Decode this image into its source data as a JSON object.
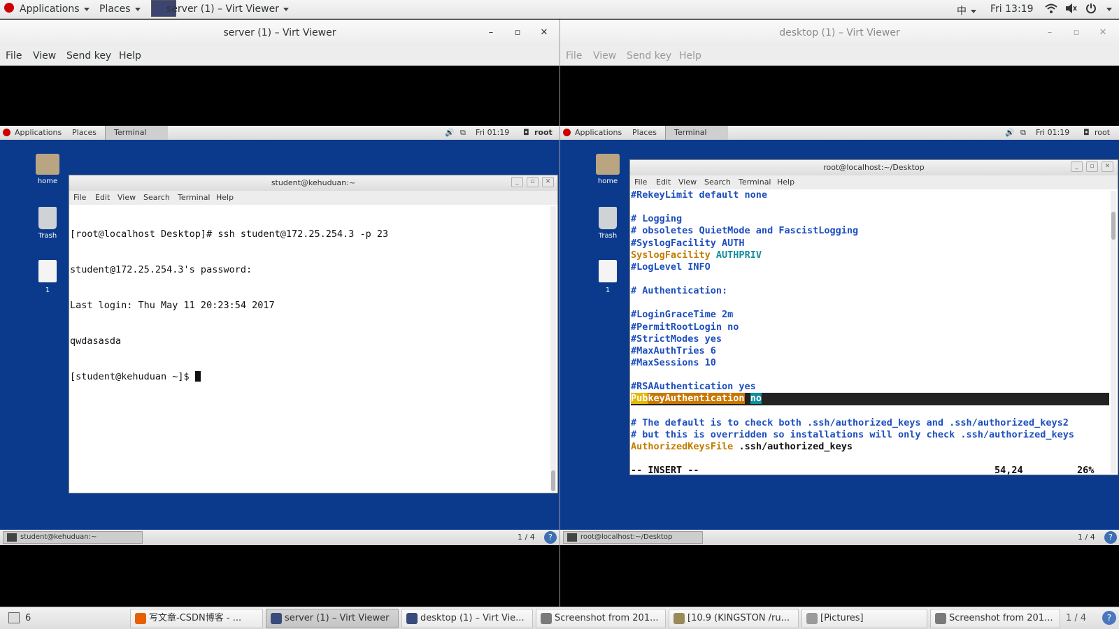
{
  "top_panel": {
    "applications": "Applications",
    "places": "Places",
    "active_window": "server (1) – Virt Viewer",
    "input_method": "中",
    "clock": "Fri 13:19"
  },
  "server_window": {
    "title": "server (1) – Virt Viewer",
    "menu": [
      "File",
      "View",
      "Send key",
      "Help"
    ],
    "guest": {
      "panel": {
        "applications": "Applications",
        "places": "Places",
        "terminal_tab": "Terminal",
        "clock": "Fri 01:19",
        "user": "root"
      },
      "desktop_icons": [
        "home",
        "Trash",
        "1"
      ],
      "terminal": {
        "title": "student@kehuduan:~",
        "menu": [
          "File",
          "Edit",
          "View",
          "Search",
          "Terminal",
          "Help"
        ],
        "lines": [
          "[root@localhost Desktop]# ssh student@172.25.254.3 -p 23",
          "student@172.25.254.3's password:",
          "Last login: Thu May 11 20:23:54 2017",
          "qwdasasda",
          "[student@kehuduan ~]$ "
        ]
      },
      "bottom": {
        "task": "student@kehuduan:~",
        "page": "1 / 4"
      }
    }
  },
  "desktop_window": {
    "title": "desktop (1) – Virt Viewer",
    "menu": [
      "File",
      "View",
      "Send key",
      "Help"
    ],
    "guest": {
      "panel": {
        "applications": "Applications",
        "places": "Places",
        "terminal_tab": "Terminal",
        "clock": "Fri 01:19",
        "user": "root"
      },
      "desktop_icons": [
        "home",
        "Trash",
        "1"
      ],
      "terminal": {
        "title": "root@localhost:~/Desktop",
        "menu": [
          "File",
          "Edit",
          "View",
          "Search",
          "Terminal",
          "Help"
        ],
        "vim_lines": [
          {
            "parts": [
              {
                "t": "#RekeyLimit default none",
                "c": "blue"
              }
            ]
          },
          {
            "parts": [
              {
                "t": "",
                "c": ""
              }
            ]
          },
          {
            "parts": [
              {
                "t": "# Logging",
                "c": "blue"
              }
            ]
          },
          {
            "parts": [
              {
                "t": "# obsoletes QuietMode and FascistLogging",
                "c": "blue"
              }
            ]
          },
          {
            "parts": [
              {
                "t": "#SyslogFacility AUTH",
                "c": "blue"
              }
            ]
          },
          {
            "parts": [
              {
                "t": "SyslogFacility",
                "c": "orange"
              },
              {
                "t": " AUTHPRIV",
                "c": "teal"
              }
            ]
          },
          {
            "parts": [
              {
                "t": "#LogLevel INFO",
                "c": "blue"
              }
            ]
          },
          {
            "parts": [
              {
                "t": "",
                "c": ""
              }
            ]
          },
          {
            "parts": [
              {
                "t": "# Authentication:",
                "c": "blue"
              }
            ]
          },
          {
            "parts": [
              {
                "t": "",
                "c": ""
              }
            ]
          },
          {
            "parts": [
              {
                "t": "#LoginGraceTime 2m",
                "c": "blue"
              }
            ]
          },
          {
            "parts": [
              {
                "t": "#PermitRootLogin no",
                "c": "blue"
              }
            ]
          },
          {
            "parts": [
              {
                "t": "#StrictModes yes",
                "c": "blue"
              }
            ]
          },
          {
            "parts": [
              {
                "t": "#MaxAuthTries 6",
                "c": "blue"
              }
            ]
          },
          {
            "parts": [
              {
                "t": "#MaxSessions 10",
                "c": "blue"
              }
            ]
          },
          {
            "parts": [
              {
                "t": "",
                "c": ""
              }
            ]
          },
          {
            "parts": [
              {
                "t": "#RSAAuthentication yes",
                "c": "blue"
              }
            ]
          },
          {
            "cursorline": true,
            "parts": [
              {
                "t": "Pub",
                "c": "hl1"
              },
              {
                "t": "keyAuthentication",
                "c": "hl2"
              },
              {
                "t": " ",
                "c": ""
              },
              {
                "t": "no",
                "c": "hl3"
              }
            ]
          },
          {
            "parts": [
              {
                "t": "",
                "c": ""
              }
            ]
          },
          {
            "parts": [
              {
                "t": "# The default is to check both .ssh/authorized_keys and .ssh/authorized_keys2",
                "c": "blue"
              }
            ]
          },
          {
            "parts": [
              {
                "t": "# but this is overridden so installations will only check .ssh/authorized_keys",
                "c": "blue"
              }
            ]
          },
          {
            "parts": [
              {
                "t": "AuthorizedKeysFile",
                "c": "orange"
              },
              {
                "t": " .ssh/authorized_keys",
                "c": ""
              }
            ]
          },
          {
            "parts": [
              {
                "t": "",
                "c": ""
              }
            ]
          }
        ],
        "status_mode": "-- INSERT --",
        "status_pos": "54,24",
        "status_pct": "26%"
      },
      "bottom": {
        "task": "root@localhost:~/Desktop",
        "page": "1 / 4"
      }
    }
  },
  "taskbar": {
    "workspace_count": "6",
    "tasks": [
      {
        "label": "写文章-CSDN博客 - ...",
        "icon_color": "#e66000"
      },
      {
        "label": "server (1) – Virt Viewer",
        "icon_color": "#3a4a7a",
        "active": true
      },
      {
        "label": "desktop (1) – Virt Vie...",
        "icon_color": "#3a4a7a"
      },
      {
        "label": "Screenshot from 201...",
        "icon_color": "#7a7a7a"
      },
      {
        "label": "[10.9 (KINGSTON /ru...",
        "icon_color": "#9a8a5a"
      },
      {
        "label": "[Pictures]",
        "icon_color": "#9a9a9a"
      },
      {
        "label": "Screenshot from 201...",
        "icon_color": "#7a7a7a"
      }
    ],
    "page": "1 / 4"
  },
  "colors": {
    "guest_desktop": "#0b3a8c",
    "comment_blue": "#1d4fbf",
    "keyword_orange": "#c27c00",
    "value_teal": "#0f8d99"
  }
}
